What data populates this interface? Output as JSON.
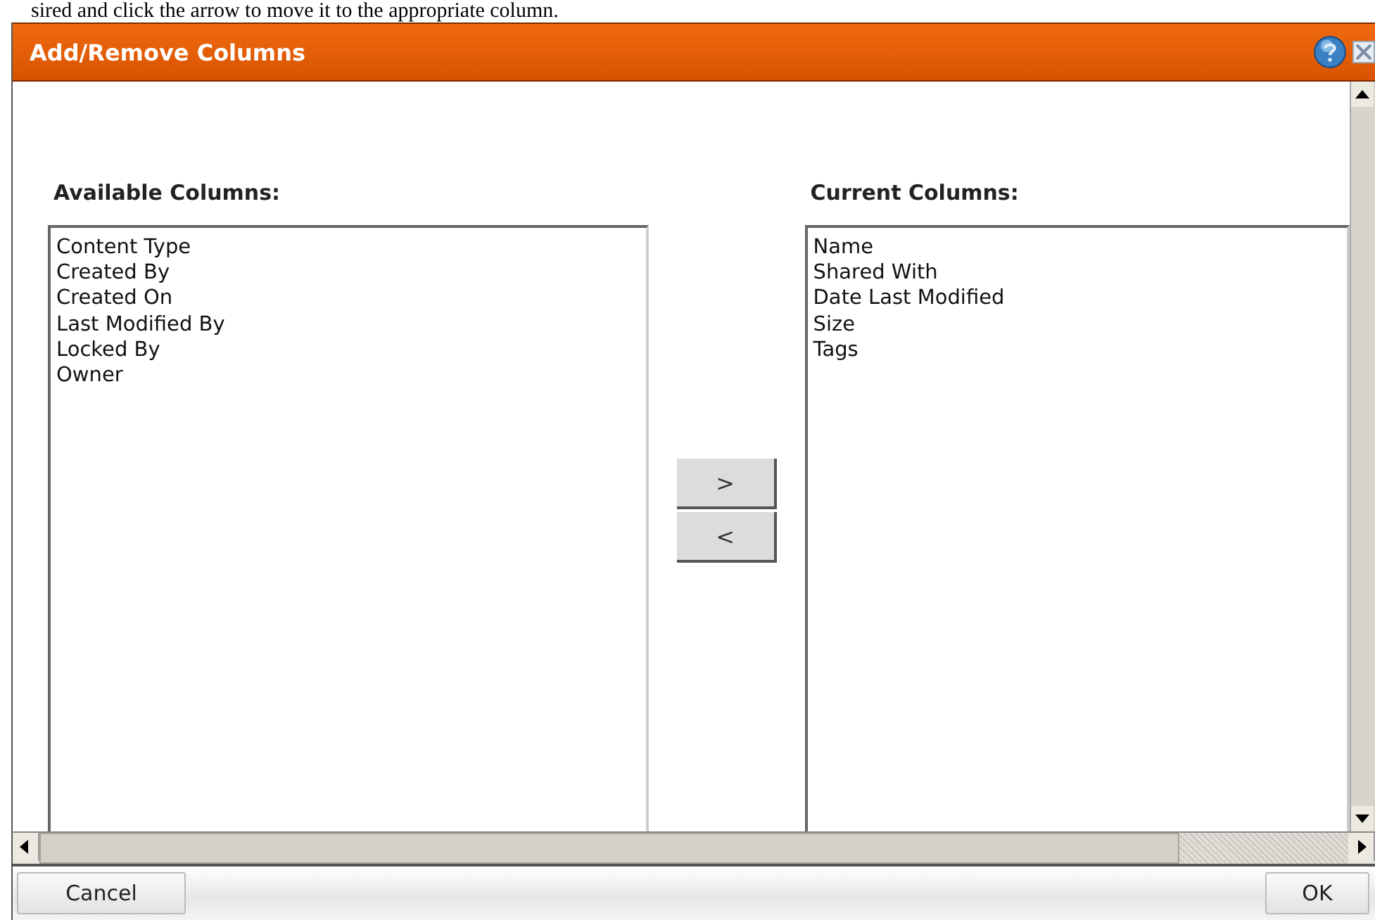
{
  "instruction": "sired and click the arrow to move it to the appropriate column.",
  "dialog": {
    "title": "Add/Remove Columns"
  },
  "available": {
    "heading": "Available Columns:",
    "items": [
      "Content Type",
      "Created By",
      "Created On",
      "Last Modified By",
      "Locked By",
      "Owner"
    ]
  },
  "move_buttons": [
    ">",
    "<"
  ],
  "current": {
    "heading": "Current Columns:",
    "items": [
      "Name",
      "Shared With",
      "Date Last Modified",
      "Size",
      "Tags"
    ]
  },
  "footer_buttons": [
    "Cancel",
    "OK"
  ]
}
